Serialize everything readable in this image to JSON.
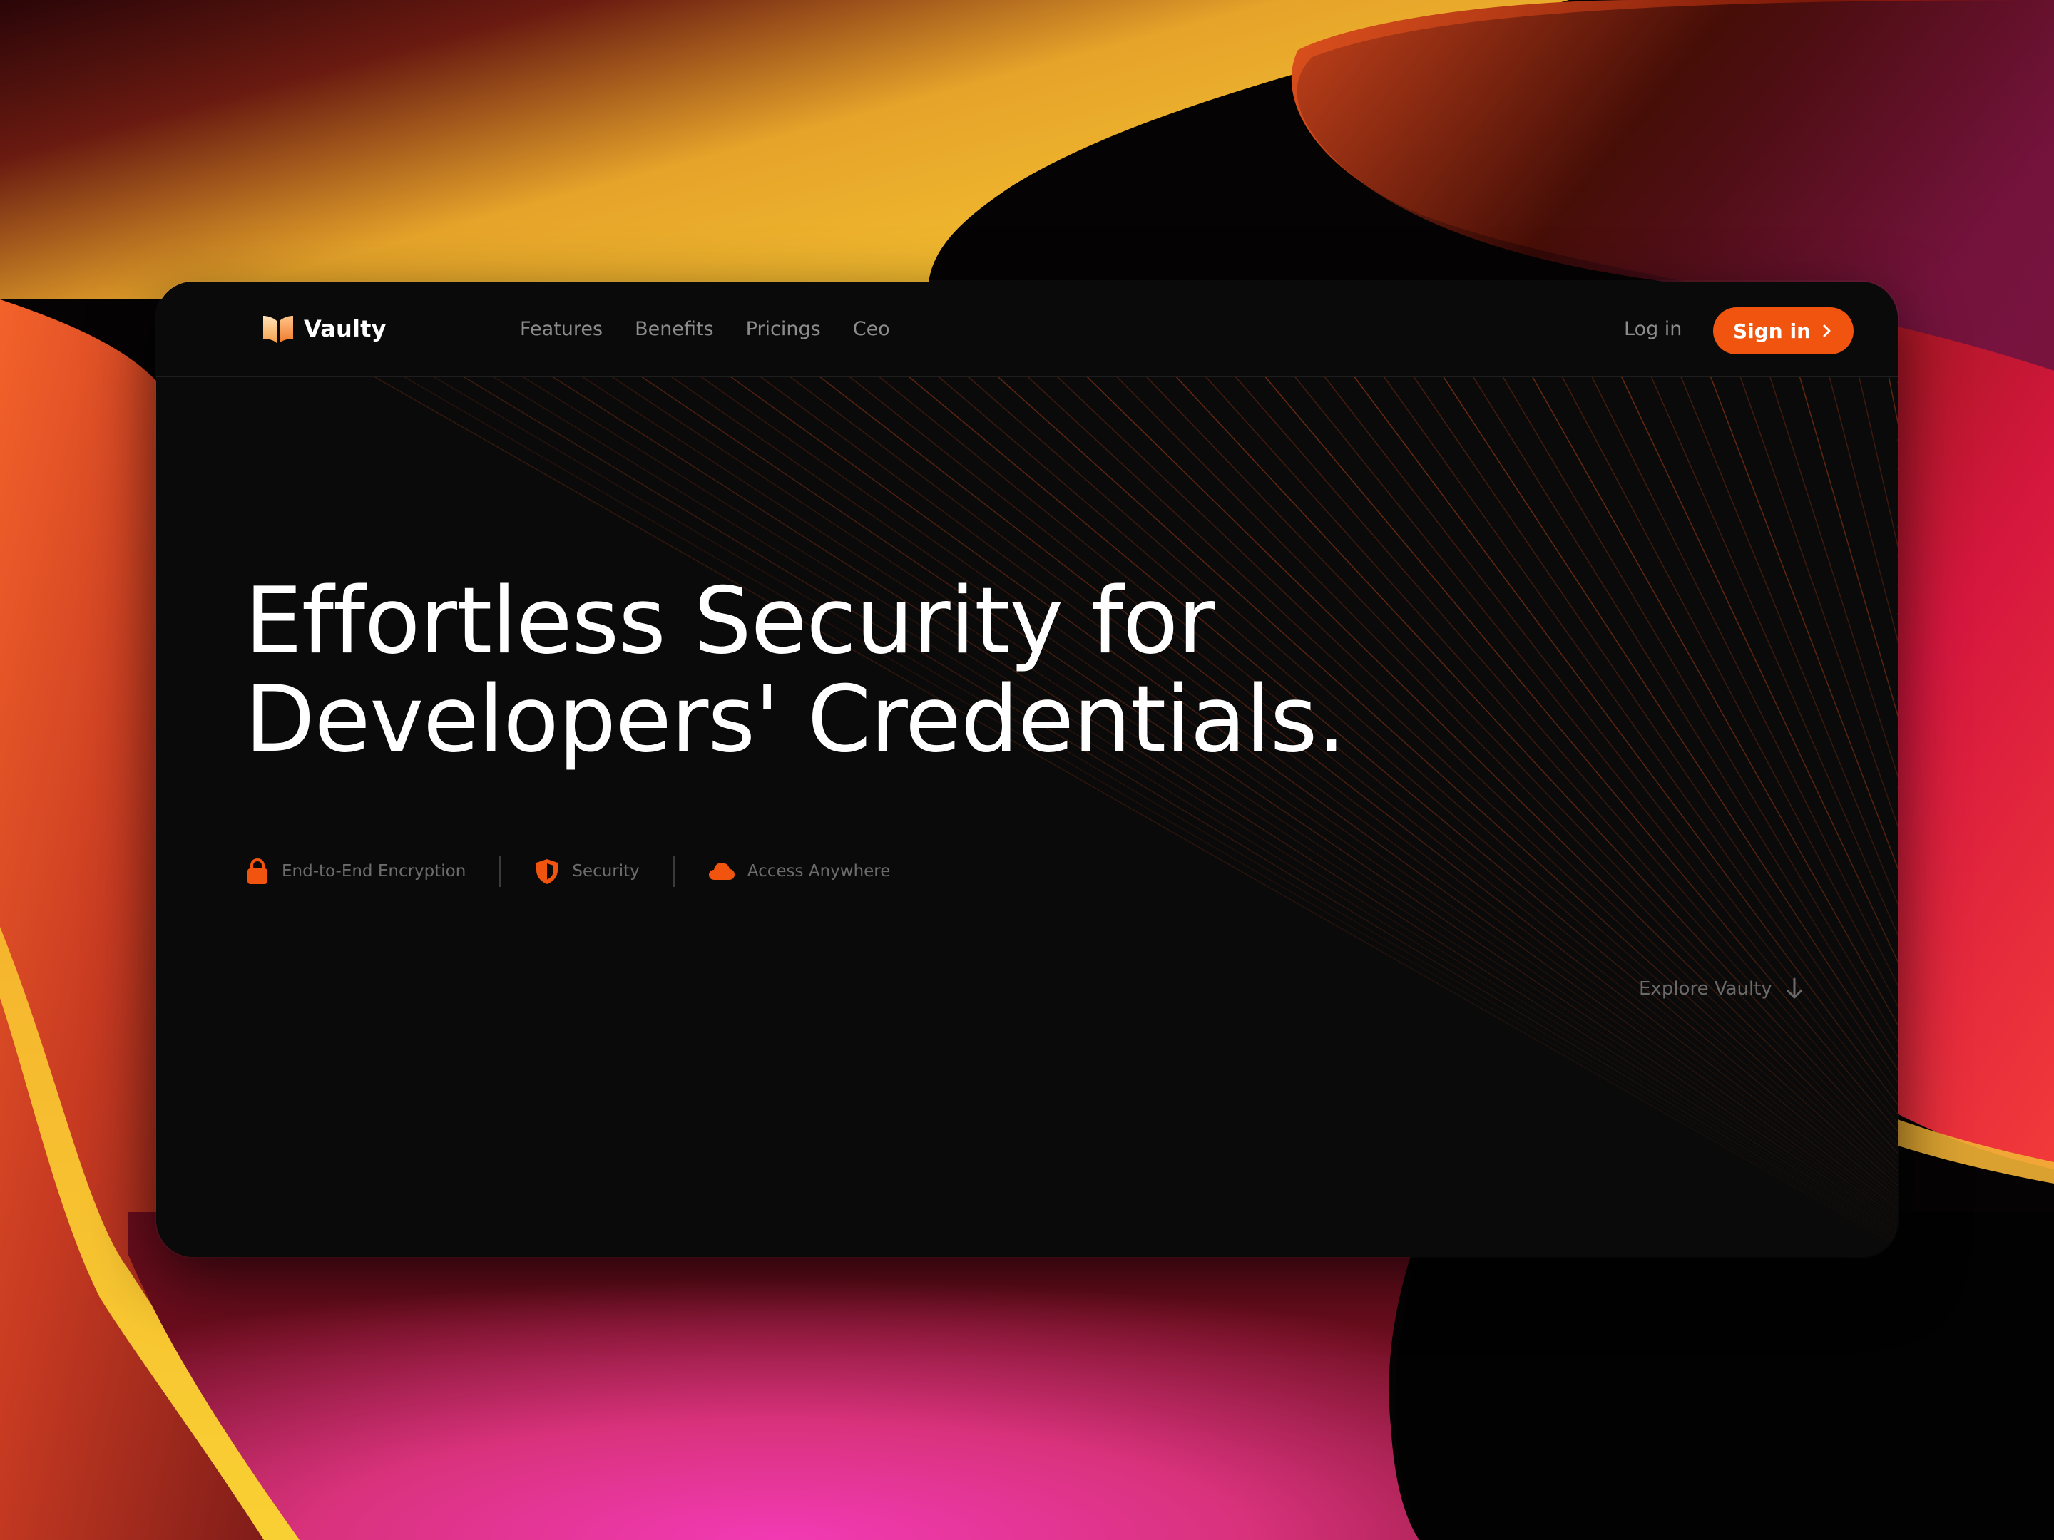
{
  "brand": {
    "name": "Vaulty",
    "logo_icon": "open-book-icon"
  },
  "nav": {
    "links": [
      "Features",
      "Benefits",
      "Pricings",
      "Ceo"
    ],
    "login_label": "Log in",
    "signin_label": "Sign in",
    "signin_icon": "chevron-right-icon"
  },
  "hero": {
    "line1": "Effortless Security for",
    "line2": "Developers' Credentials."
  },
  "features": [
    {
      "label": "End-to-End Encryption",
      "icon": "lock-icon"
    },
    {
      "label": "Security",
      "icon": "shield-icon"
    },
    {
      "label": "Access Anywhere",
      "icon": "cloud-icon"
    }
  ],
  "explore": {
    "label": "Explore Vaulty",
    "icon": "arrow-down-icon"
  },
  "colors": {
    "accent": "#f0540f",
    "window_bg": "#0a0a0a",
    "nav_text": "#8c8c8c",
    "hero_text": "#ffffff",
    "muted_text": "#6c6c6c"
  }
}
